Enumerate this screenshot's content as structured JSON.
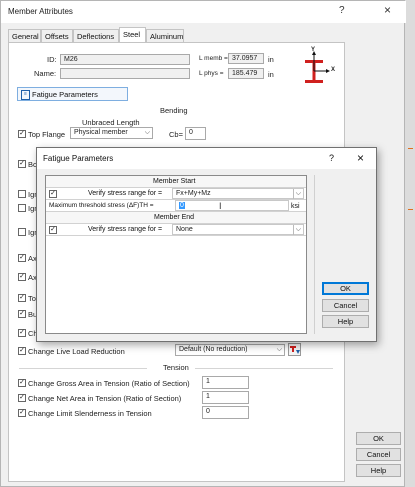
{
  "window": {
    "title": "Member Attributes",
    "help_glyph": "?",
    "close_glyph": "×"
  },
  "tabs": [
    "General",
    "Offsets",
    "Deflections",
    "Steel",
    "Aluminum"
  ],
  "steel": {
    "id_label": "ID:",
    "id_value": "M26",
    "name_label": "Name:",
    "name_value": "",
    "lmemb_label": "L memb =",
    "lmemb_value": "37.0957",
    "lmemb_unit": "in",
    "lphys_label": "L phys =",
    "lphys_value": "185.479",
    "lphys_unit": "in",
    "axis_y": "Y",
    "axis_x": "X",
    "fatigue_button": "Fatigue Parameters",
    "bending_header": "Bending",
    "unbraced_header": "Unbraced Length",
    "top_flange_label": "Top Flange",
    "top_flange_value": "Physical member",
    "cb_label": "Cb=",
    "cb_value": "0",
    "partial_rows": [
      "Bo",
      "Ign",
      "Ign",
      "Ign",
      "Ax",
      "Ax",
      "Tor",
      "Bu",
      "Ch"
    ],
    "live_load_label": "Change Live Load Reduction",
    "live_load_value": "Default (No reduction)",
    "tension_header": "Tension",
    "gross_area_label": "Change Gross Area in Tension (Ratio of Section)",
    "gross_area_value": "1",
    "net_area_label": "Change Net Area in Tension (Ratio of Section)",
    "net_area_value": "1",
    "slenderness_label": "Change Limit Slenderness in Tension",
    "slenderness_value": "0"
  },
  "main_buttons": {
    "ok": "OK",
    "cancel": "Cancel",
    "help": "Help"
  },
  "fatigue_dialog": {
    "title": "Fatigue Parameters",
    "help_glyph": "?",
    "close_glyph": "×",
    "member_start_header": "Member Start",
    "verify_label": "Verify stress range for =",
    "verify_start_value": "Fx+My+Mz",
    "threshold_label": "Maximum threshold stress (ΔF)TH =",
    "threshold_value": "0",
    "threshold_unit": "ksi",
    "member_end_header": "Member End",
    "verify_end_value": "None",
    "ok": "OK",
    "cancel": "Cancel",
    "help": "Help"
  },
  "colors": {
    "accent": "#0078d7",
    "beam_red": "#d0201e",
    "icon_blue": "#1f5fa8"
  }
}
